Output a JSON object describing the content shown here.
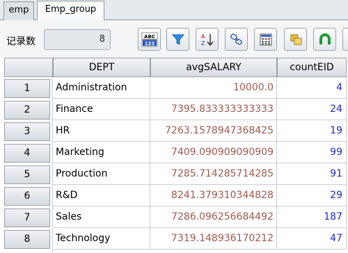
{
  "tabs": [
    {
      "label": "emp",
      "active": false
    },
    {
      "label": "Emp_group",
      "active": true
    }
  ],
  "toolbar": {
    "record_count_label": "记录数",
    "record_count_value": "8",
    "abc_icon_top": "ABC",
    "abc_icon_bottom": "123",
    "buttons": [
      "abc-123-format-icon",
      "filter-icon",
      "sort-az-icon",
      "link-icon",
      "calculator-icon",
      "copy-icon",
      "magnet-icon"
    ]
  },
  "grid": {
    "columns": [
      "DEPT",
      "avgSALARY",
      "countEID"
    ],
    "rows": [
      {
        "num": "1",
        "dept": "Administration",
        "avg": "10000.0",
        "count": "4"
      },
      {
        "num": "2",
        "dept": "Finance",
        "avg": "7395.833333333333",
        "count": "24"
      },
      {
        "num": "3",
        "dept": "HR",
        "avg": "7263.1578947368425",
        "count": "19"
      },
      {
        "num": "4",
        "dept": "Marketing",
        "avg": "7409.090909090909",
        "count": "99"
      },
      {
        "num": "5",
        "dept": "Production",
        "avg": "7285.714285714285",
        "count": "91"
      },
      {
        "num": "6",
        "dept": "R&D",
        "avg": "8241.379310344828",
        "count": "29"
      },
      {
        "num": "7",
        "dept": "Sales",
        "avg": "7286.096256684492",
        "count": "187"
      },
      {
        "num": "8",
        "dept": "Technology",
        "avg": "7319.148936170212",
        "count": "47"
      }
    ]
  },
  "colors": {
    "salary_text": "#a0584f",
    "count_text": "#1d27c8"
  }
}
